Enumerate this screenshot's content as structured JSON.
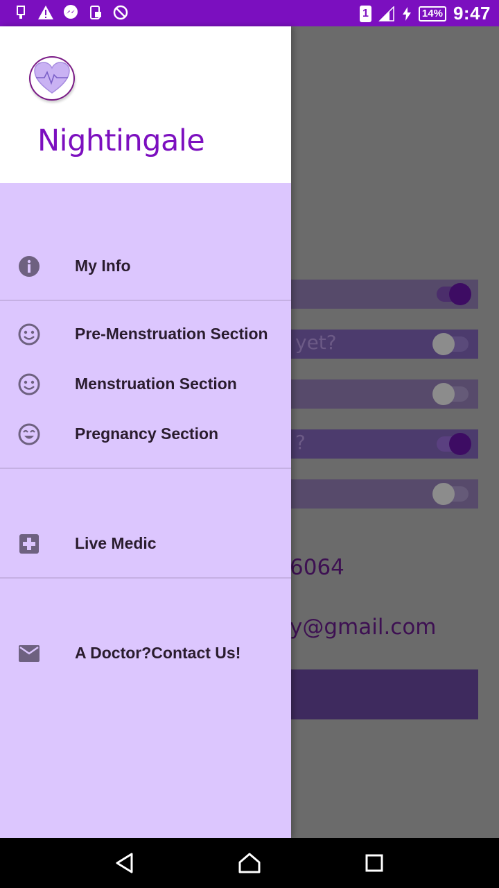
{
  "status_bar": {
    "left_icons": [
      "usb-icon",
      "warning-icon",
      "messenger-icon",
      "screenshot-icon",
      "no-sync-icon"
    ],
    "sim_badge": "1",
    "battery": "14%",
    "time": "9:47"
  },
  "background": {
    "row_texts": [
      "yet?",
      "?"
    ],
    "phone_fragment": "6064",
    "email_fragment": "y@gmail.com"
  },
  "drawer": {
    "app_name": "Nightingale",
    "items": [
      {
        "label": "My Info",
        "icon": "info-icon"
      },
      {
        "label": "Pre-Menstruation Section",
        "icon": "smiley-icon"
      },
      {
        "label": "Menstruation Section",
        "icon": "smiley-icon"
      },
      {
        "label": "Pregnancy Section",
        "icon": "grin-icon"
      },
      {
        "label": "Live Medic",
        "icon": "medical-plus-icon"
      },
      {
        "label": "A Doctor?Contact Us!",
        "icon": "mail-icon"
      }
    ]
  },
  "colors": {
    "status_bar": "#7b0fbf",
    "drawer_bg": "#dcc6fe",
    "accent": "#7c0fbf"
  }
}
